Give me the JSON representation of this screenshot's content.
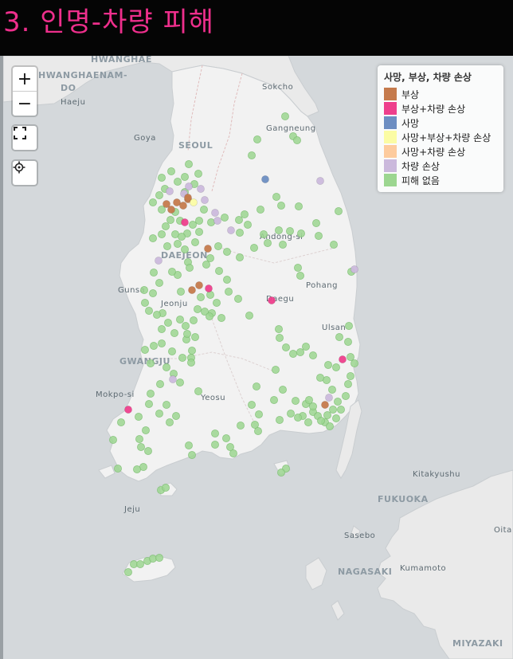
{
  "title": "3.  인명-차량  피해",
  "controls": {
    "zoom_in": "+",
    "zoom_out": "−"
  },
  "legend": {
    "title": "사망, 부상, 차량 손상",
    "items": [
      {
        "label": "부상",
        "color": "#c57a4c"
      },
      {
        "label": "부상+차량 손상",
        "color": "#ee3f8c"
      },
      {
        "label": "사망",
        "color": "#6d8ec2"
      },
      {
        "label": "사망+부상+차량 손상",
        "color": "#fbfca4"
      },
      {
        "label": "사망+차량 손상",
        "color": "#fdcb9e"
      },
      {
        "label": "차량 손상",
        "color": "#cbb9dc"
      },
      {
        "label": "피해 없음",
        "color": "#9cd690"
      }
    ]
  },
  "map_labels": {
    "hwanghae": "HWANGHAE",
    "hwanghaenam": "HWANGHAENAM-",
    "do": "DO",
    "haeju": "Haeju",
    "sokcho": "Sokcho",
    "gangneung": "Gangneung",
    "goyang": "Goya",
    "seoul": "SEOUL",
    "andong": "Andong-si",
    "daejeon": "DAEJEON",
    "gunsan": "Gunsa",
    "jeonju": "Jeonju",
    "daegu": "Daegu",
    "pohang": "Pohang",
    "ulsan": "Ulsan",
    "gwangju": "GWANGJU",
    "mokpo": "Mokpo-si",
    "yeosu": "Yeosu",
    "jeju": "Jeju",
    "kitakyushu": "Kitakyushu",
    "fukuoka": "FUKUOKA",
    "sasebo": "Sasebo",
    "nagasaki": "NAGASAKI",
    "kumamoto": "Kumamoto",
    "oita": "Oita",
    "miyazaki": "MIYAZAKI"
  },
  "markers": {
    "injury": [
      [
        218,
        184
      ],
      [
        211,
        193
      ],
      [
        205,
        186
      ],
      [
        232,
        180
      ],
      [
        257,
        242
      ],
      [
        246,
        288
      ],
      [
        237,
        294
      ],
      [
        404,
        438
      ],
      [
        226,
        188
      ],
      [
        232,
        178
      ]
    ],
    "injury_vehicle": [
      [
        228,
        209
      ],
      [
        258,
        292
      ],
      [
        337,
        307
      ],
      [
        426,
        381
      ],
      [
        157,
        444
      ]
    ],
    "death": [
      [
        329,
        155
      ]
    ],
    "death_injury_vehicle": [
      [
        239,
        184
      ]
    ],
    "vehicle": [
      [
        248,
        167
      ],
      [
        253,
        181
      ],
      [
        209,
        170
      ],
      [
        266,
        197
      ],
      [
        269,
        207
      ],
      [
        286,
        219
      ],
      [
        195,
        257
      ],
      [
        213,
        406
      ],
      [
        398,
        157
      ],
      [
        441,
        268
      ],
      [
        409,
        429
      ],
      [
        233,
        164
      ],
      [
        227,
        173
      ]
    ],
    "none": [
      [
        354,
        76
      ],
      [
        364,
        101
      ],
      [
        369,
        106
      ],
      [
        319,
        105
      ],
      [
        312,
        125
      ],
      [
        233,
        136
      ],
      [
        211,
        145
      ],
      [
        199,
        153
      ],
      [
        219,
        158
      ],
      [
        228,
        152
      ],
      [
        245,
        148
      ],
      [
        240,
        161
      ],
      [
        228,
        171
      ],
      [
        203,
        167
      ],
      [
        196,
        175
      ],
      [
        188,
        184
      ],
      [
        199,
        193
      ],
      [
        216,
        196
      ],
      [
        210,
        206
      ],
      [
        204,
        214
      ],
      [
        222,
        207
      ],
      [
        231,
        223
      ],
      [
        216,
        224
      ],
      [
        199,
        224
      ],
      [
        188,
        229
      ],
      [
        206,
        239
      ],
      [
        219,
        236
      ],
      [
        228,
        243
      ],
      [
        241,
        234
      ],
      [
        246,
        221
      ],
      [
        238,
        212
      ],
      [
        224,
        227
      ],
      [
        246,
        207
      ],
      [
        252,
        193
      ],
      [
        261,
        209
      ],
      [
        278,
        203
      ],
      [
        296,
        206
      ],
      [
        303,
        199
      ],
      [
        307,
        212
      ],
      [
        297,
        222
      ],
      [
        323,
        193
      ],
      [
        343,
        177
      ],
      [
        349,
        188
      ],
      [
        371,
        189
      ],
      [
        327,
        224
      ],
      [
        332,
        235
      ],
      [
        351,
        237
      ],
      [
        346,
        219
      ],
      [
        360,
        220
      ],
      [
        374,
        223
      ],
      [
        393,
        210
      ],
      [
        396,
        226
      ],
      [
        421,
        195
      ],
      [
        415,
        237
      ],
      [
        370,
        266
      ],
      [
        373,
        276
      ],
      [
        315,
        241
      ],
      [
        297,
        253
      ],
      [
        281,
        246
      ],
      [
        270,
        239
      ],
      [
        260,
        254
      ],
      [
        232,
        259
      ],
      [
        219,
        275
      ],
      [
        223,
        296
      ],
      [
        212,
        271
      ],
      [
        234,
        266
      ],
      [
        255,
        262
      ],
      [
        271,
        270
      ],
      [
        281,
        281
      ],
      [
        260,
        300
      ],
      [
        248,
        303
      ],
      [
        244,
        318
      ],
      [
        253,
        321
      ],
      [
        262,
        323
      ],
      [
        268,
        310
      ],
      [
        283,
        296
      ],
      [
        295,
        305
      ],
      [
        309,
        326
      ],
      [
        274,
        329
      ],
      [
        239,
        332
      ],
      [
        229,
        339
      ],
      [
        222,
        331
      ],
      [
        207,
        335
      ],
      [
        200,
        323
      ],
      [
        183,
        320
      ],
      [
        188,
        298
      ],
      [
        196,
        285
      ],
      [
        189,
        272
      ],
      [
        177,
        294
      ],
      [
        178,
        310
      ],
      [
        193,
        325
      ],
      [
        199,
        343
      ],
      [
        215,
        348
      ],
      [
        230,
        356
      ],
      [
        237,
        370
      ],
      [
        236,
        379
      ],
      [
        225,
        379
      ],
      [
        212,
        371
      ],
      [
        199,
        361
      ],
      [
        189,
        364
      ],
      [
        178,
        369
      ],
      [
        185,
        386
      ],
      [
        205,
        391
      ],
      [
        214,
        399
      ],
      [
        197,
        412
      ],
      [
        185,
        424
      ],
      [
        205,
        438
      ],
      [
        217,
        452
      ],
      [
        209,
        460
      ],
      [
        196,
        449
      ],
      [
        183,
        437
      ],
      [
        170,
        453
      ],
      [
        179,
        470
      ],
      [
        171,
        481
      ],
      [
        173,
        491
      ],
      [
        148,
        460
      ],
      [
        138,
        482
      ],
      [
        182,
        496
      ],
      [
        176,
        516
      ],
      [
        168,
        519
      ],
      [
        144,
        518
      ],
      [
        198,
        545
      ],
      [
        204,
        542
      ],
      [
        233,
        489
      ],
      [
        237,
        501
      ],
      [
        266,
        474
      ],
      [
        280,
        480
      ],
      [
        285,
        491
      ],
      [
        289,
        499
      ],
      [
        266,
        488
      ],
      [
        298,
        464
      ],
      [
        316,
        463
      ],
      [
        321,
        450
      ],
      [
        312,
        438
      ],
      [
        320,
        471
      ],
      [
        347,
        457
      ],
      [
        340,
        432
      ],
      [
        351,
        419
      ],
      [
        361,
        449
      ],
      [
        367,
        433
      ],
      [
        380,
        437
      ],
      [
        389,
        447
      ],
      [
        395,
        452
      ],
      [
        404,
        460
      ],
      [
        407,
        451
      ],
      [
        414,
        444
      ],
      [
        420,
        434
      ],
      [
        430,
        427
      ],
      [
        433,
        412
      ],
      [
        436,
        402
      ],
      [
        441,
        386
      ],
      [
        436,
        378
      ],
      [
        433,
        359
      ],
      [
        422,
        353
      ],
      [
        434,
        339
      ],
      [
        437,
        271
      ],
      [
        346,
        343
      ],
      [
        347,
        354
      ],
      [
        355,
        366
      ],
      [
        364,
        374
      ],
      [
        373,
        372
      ],
      [
        380,
        365
      ],
      [
        389,
        376
      ],
      [
        408,
        388
      ],
      [
        418,
        391
      ],
      [
        406,
        407
      ],
      [
        398,
        404
      ],
      [
        413,
        419
      ],
      [
        342,
        394
      ],
      [
        318,
        415
      ],
      [
        245,
        421
      ],
      [
        222,
        410
      ],
      [
        236,
        385
      ],
      [
        355,
        518
      ],
      [
        349,
        523
      ],
      [
        157,
        648
      ],
      [
        164,
        638
      ],
      [
        172,
        638
      ],
      [
        181,
        634
      ],
      [
        188,
        631
      ],
      [
        196,
        630
      ],
      [
        410,
        465
      ],
      [
        418,
        455
      ],
      [
        424,
        444
      ],
      [
        389,
        440
      ],
      [
        384,
        432
      ],
      [
        376,
        452
      ],
      [
        383,
        460
      ],
      [
        370,
        454
      ],
      [
        399,
        458
      ],
      [
        259,
        327
      ],
      [
        241,
        353
      ],
      [
        231,
        349
      ]
    ]
  }
}
